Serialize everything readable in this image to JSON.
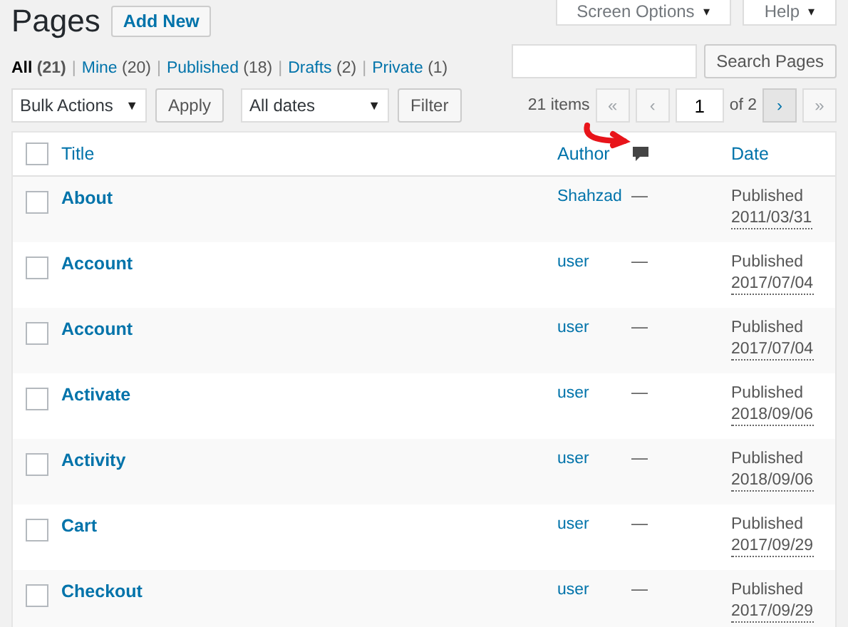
{
  "top_tabs": [
    {
      "label": "Screen Options",
      "caret": "▾"
    },
    {
      "label": "Help",
      "caret": "▾"
    }
  ],
  "title": "Pages",
  "add_new": "Add New",
  "filter_separator": "|",
  "dropdown_caret": "▼",
  "filters": [
    {
      "label": "All",
      "count": "(21)",
      "selected": true
    },
    {
      "label": "Mine",
      "count": "(20)",
      "selected": false
    },
    {
      "label": "Published",
      "count": "(18)",
      "selected": false
    },
    {
      "label": "Drafts",
      "count": "(2)",
      "selected": false
    },
    {
      "label": "Private",
      "count": "(1)",
      "selected": false
    }
  ],
  "search": {
    "button": "Search Pages"
  },
  "bulk_actions": {
    "value": "Bulk Actions",
    "apply": "Apply"
  },
  "dates": {
    "value": "All dates",
    "filter": "Filter"
  },
  "pagination": {
    "items": "21 items",
    "first": "«",
    "prev": "‹",
    "page": "1",
    "of": "of 2",
    "next": "›",
    "last": "»",
    "first_disabled": true,
    "prev_disabled": true,
    "next_disabled": false,
    "last_disabled": true
  },
  "table": {
    "select_all_checked": false,
    "columns": {
      "title": "Title",
      "author": "Author",
      "date": "Date"
    },
    "rows": [
      {
        "title": "About",
        "author": "Shahzad",
        "comments": "—",
        "status": "Published",
        "date": "2011/03/31",
        "checked": false
      },
      {
        "title": "Account",
        "author": "user",
        "comments": "—",
        "status": "Published",
        "date": "2017/07/04",
        "checked": false
      },
      {
        "title": "Account",
        "author": "user",
        "comments": "—",
        "status": "Published",
        "date": "2017/07/04",
        "checked": false
      },
      {
        "title": "Activate",
        "author": "user",
        "comments": "—",
        "status": "Published",
        "date": "2018/09/06",
        "checked": false
      },
      {
        "title": "Activity",
        "author": "user",
        "comments": "—",
        "status": "Published",
        "date": "2018/09/06",
        "checked": false
      },
      {
        "title": "Cart",
        "author": "user",
        "comments": "—",
        "status": "Published",
        "date": "2017/09/29",
        "checked": false
      },
      {
        "title": "Checkout",
        "author": "user",
        "comments": "—",
        "status": "Published",
        "date": "2017/09/29",
        "checked": false
      }
    ]
  }
}
